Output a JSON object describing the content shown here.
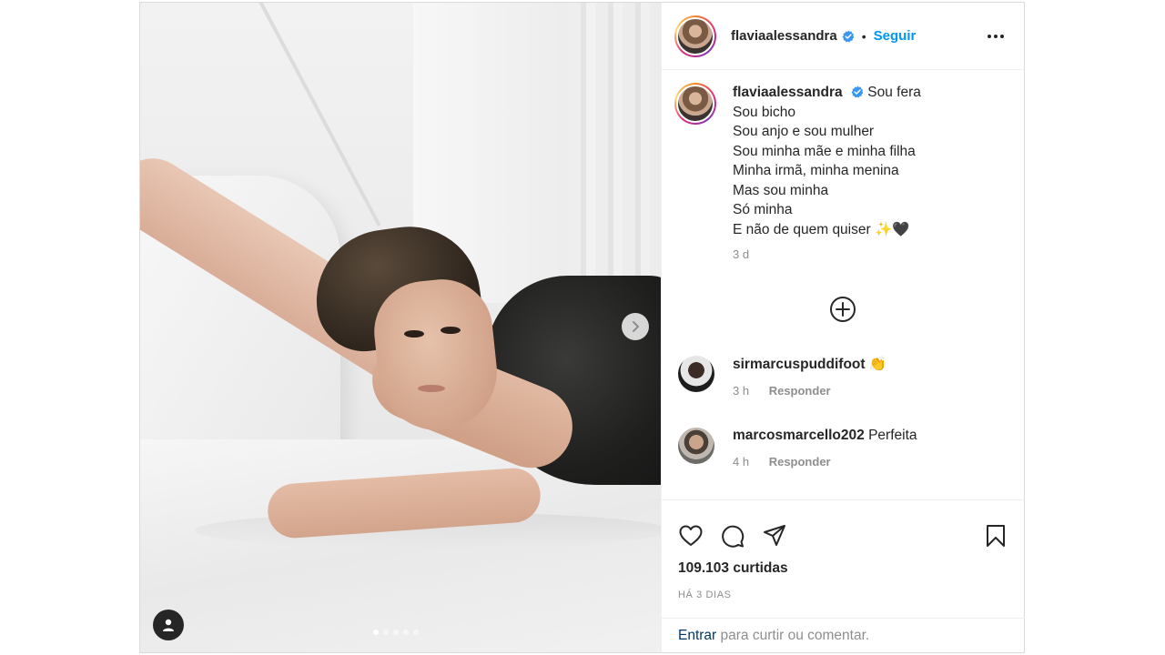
{
  "post": {
    "carousel": {
      "total_slides": 5,
      "active_slide": 1
    },
    "author": {
      "username": "flaviaalessandra",
      "separator": "•",
      "follow_label": "Seguir"
    },
    "caption": {
      "username": "flaviaalessandra",
      "lines": [
        "Sou fera",
        "Sou bicho",
        "Sou anjo e sou mulher",
        "Sou minha mãe e minha filha",
        "Minha irmã, minha menina",
        "Mas sou minha",
        "Só minha",
        "E não de quem quiser ✨🖤"
      ],
      "time": "3 d"
    },
    "comments": [
      {
        "username": "sirmarcuspuddifoot",
        "text": "👏",
        "time": "3 h",
        "reply_label": "Responder"
      },
      {
        "username": "marcosmarcello202",
        "text": "Perfeita",
        "time": "4 h",
        "reply_label": "Responder"
      }
    ],
    "likes": "109.103 curtidas",
    "date": "HÁ 3 DIAS",
    "login_prompt": {
      "link": "Entrar",
      "rest": " para curtir ou comentar."
    },
    "icons": {
      "like": "heart-icon",
      "comment": "comment-icon",
      "share": "send-icon",
      "save": "bookmark-icon",
      "load_more": "plus-circle-icon",
      "verified": "verified-badge-icon",
      "more": "more-options-icon",
      "next": "chevron-right-icon",
      "tags": "user-tag-icon"
    },
    "colors": {
      "follow_blue": "#0095f6",
      "verified_blue": "#3897f0",
      "muted": "#8e8e8e",
      "link_dark": "#00376b"
    }
  }
}
